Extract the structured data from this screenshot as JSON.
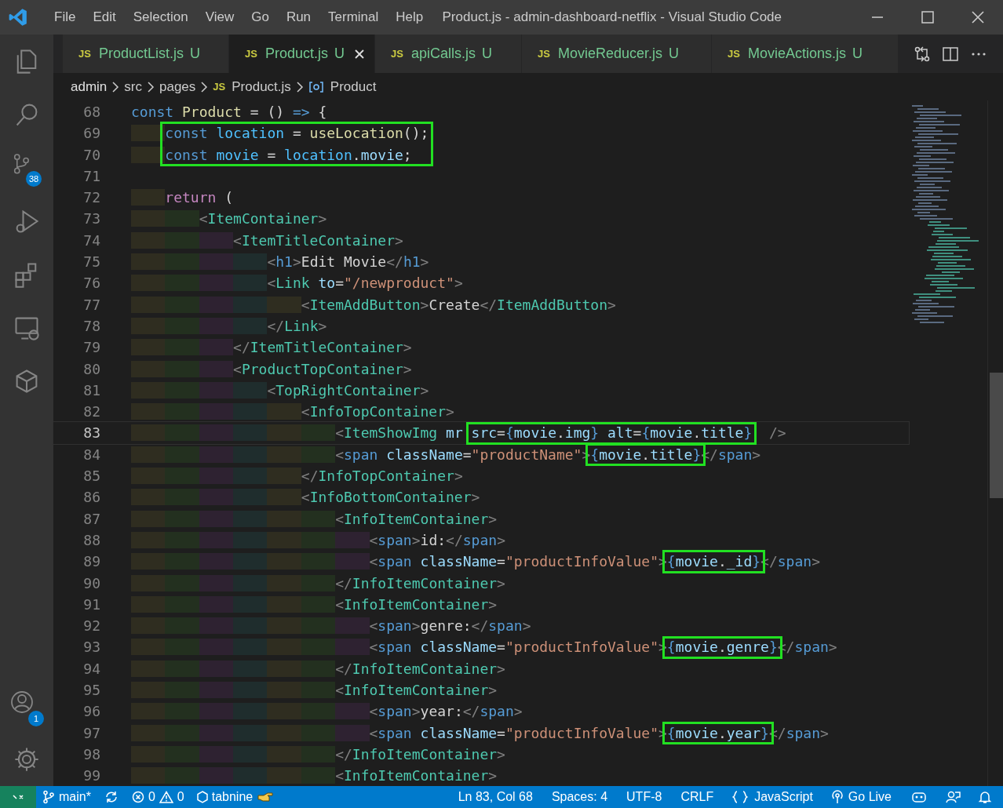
{
  "window": {
    "title": "Product.js - admin-dashboard-netflix - Visual Studio Code"
  },
  "menu": [
    "File",
    "Edit",
    "Selection",
    "View",
    "Go",
    "Run",
    "Terminal",
    "Help"
  ],
  "activity_bar": {
    "source_control_badge": "38",
    "accounts_badge": "1"
  },
  "tabs": [
    {
      "badge": "JS",
      "name": "ProductList.js",
      "status": "U",
      "selected": false
    },
    {
      "badge": "JS",
      "name": "Product.js",
      "status": "U",
      "selected": true
    },
    {
      "badge": "JS",
      "name": "apiCalls.js",
      "status": "U",
      "selected": false
    },
    {
      "badge": "JS",
      "name": "MovieReducer.js",
      "status": "U",
      "selected": false
    },
    {
      "badge": "JS",
      "name": "MovieActions.js",
      "status": "U",
      "selected": false
    }
  ],
  "breadcrumb": [
    {
      "kind": "folder",
      "text": "admin"
    },
    {
      "kind": "folder",
      "text": "src"
    },
    {
      "kind": "folder",
      "text": "pages"
    },
    {
      "kind": "file",
      "badge": "JS",
      "text": "Product.js"
    },
    {
      "kind": "symbol",
      "text": "Product"
    }
  ],
  "editor": {
    "lines": [
      {
        "kind": "line",
        "number": "68",
        "current": false,
        "tokens": [
          {
            "kind": "keyword",
            "text": "const"
          },
          {
            "kind": "function",
            "text": " Product"
          },
          {
            "kind": "plain",
            "text": " = () "
          },
          {
            "kind": "keyword",
            "text": "=>"
          },
          {
            "kind": "plain",
            "text": " {"
          }
        ]
      },
      {
        "kind": "boxed_block",
        "lines": [
          {
            "number": "69",
            "current": false,
            "tokens": [
              {
                "kind": "keyword",
                "text": "    const"
              },
              {
                "kind": "constant",
                "text": " location"
              },
              {
                "kind": "plain",
                "text": " = "
              },
              {
                "kind": "function",
                "text": "useLocation"
              },
              {
                "kind": "plain",
                "text": "();"
              }
            ]
          },
          {
            "number": "70",
            "current": false,
            "tokens": [
              {
                "kind": "keyword",
                "text": "    const"
              },
              {
                "kind": "constant",
                "text": " movie"
              },
              {
                "kind": "plain",
                "text": " = "
              },
              {
                "kind": "constant",
                "text": "location"
              },
              {
                "kind": "plain",
                "text": "."
              },
              {
                "kind": "variable",
                "text": "movie"
              },
              {
                "kind": "plain",
                "text": ";"
              }
            ]
          }
        ]
      },
      {
        "kind": "line",
        "number": "71",
        "current": false
      },
      {
        "kind": "line",
        "number": "72",
        "current": false,
        "tokens": [
          {
            "kind": "control",
            "text": "    return"
          },
          {
            "kind": "plain",
            "text": " ("
          }
        ]
      },
      {
        "kind": "line",
        "number": "73",
        "current": false,
        "tokens": [
          {
            "kind": "bracket",
            "text": "        <"
          },
          {
            "kind": "component",
            "text": "ItemContainer"
          },
          {
            "kind": "bracket",
            "text": ">"
          }
        ]
      },
      {
        "kind": "line",
        "number": "74",
        "current": false,
        "tokens": [
          {
            "kind": "bracket",
            "text": "            <"
          },
          {
            "kind": "component",
            "text": "ItemTitleContainer"
          },
          {
            "kind": "bracket",
            "text": ">"
          }
        ]
      },
      {
        "kind": "line",
        "number": "75",
        "current": false,
        "tokens": [
          {
            "kind": "bracket",
            "text": "                <"
          },
          {
            "kind": "tag",
            "text": "h1"
          },
          {
            "kind": "bracket",
            "text": ">"
          },
          {
            "kind": "plain",
            "text": "Edit Movie"
          },
          {
            "kind": "bracket",
            "text": "</"
          },
          {
            "kind": "tag",
            "text": "h1"
          },
          {
            "kind": "bracket",
            "text": ">"
          }
        ]
      },
      {
        "kind": "line",
        "number": "76",
        "current": false,
        "tokens": [
          {
            "kind": "bracket",
            "text": "                <"
          },
          {
            "kind": "component",
            "text": "Link"
          },
          {
            "kind": "attribute",
            "text": " to"
          },
          {
            "kind": "plain",
            "text": "="
          },
          {
            "kind": "string",
            "text": "\"/newproduct\""
          },
          {
            "kind": "bracket",
            "text": ">"
          }
        ]
      },
      {
        "kind": "line",
        "number": "77",
        "current": false,
        "tokens": [
          {
            "kind": "bracket",
            "text": "                    <"
          },
          {
            "kind": "component",
            "text": "ItemAddButton"
          },
          {
            "kind": "bracket",
            "text": ">"
          },
          {
            "kind": "plain",
            "text": "Create"
          },
          {
            "kind": "bracket",
            "text": "</"
          },
          {
            "kind": "component",
            "text": "ItemAddButton"
          },
          {
            "kind": "bracket",
            "text": ">"
          }
        ]
      },
      {
        "kind": "line",
        "number": "78",
        "current": false,
        "tokens": [
          {
            "kind": "bracket",
            "text": "                </"
          },
          {
            "kind": "component",
            "text": "Link"
          },
          {
            "kind": "bracket",
            "text": ">"
          }
        ]
      },
      {
        "kind": "line",
        "number": "79",
        "current": false,
        "tokens": [
          {
            "kind": "bracket",
            "text": "            </"
          },
          {
            "kind": "component",
            "text": "ItemTitleContainer"
          },
          {
            "kind": "bracket",
            "text": ">"
          }
        ]
      },
      {
        "kind": "line",
        "number": "80",
        "current": false,
        "tokens": [
          {
            "kind": "bracket",
            "text": "            <"
          },
          {
            "kind": "component",
            "text": "ProductTopContainer"
          },
          {
            "kind": "bracket",
            "text": ">"
          }
        ]
      },
      {
        "kind": "line",
        "number": "81",
        "current": false,
        "tokens": [
          {
            "kind": "bracket",
            "text": "                <"
          },
          {
            "kind": "component",
            "text": "TopRightContainer"
          },
          {
            "kind": "bracket",
            "text": ">"
          }
        ]
      },
      {
        "kind": "line",
        "number": "82",
        "current": false,
        "tokens": [
          {
            "kind": "bracket",
            "text": "                    <"
          },
          {
            "kind": "component",
            "text": "InfoTopContainer"
          },
          {
            "kind": "bracket",
            "text": ">"
          }
        ]
      },
      {
        "kind": "line",
        "number": "83",
        "current": true,
        "tokens": [
          {
            "kind": "bracket",
            "text": "                        <"
          },
          {
            "kind": "component",
            "text": "ItemShowImg"
          },
          {
            "kind": "attribute",
            "text": " mr "
          },
          {
            "kind": "boxed",
            "tokens": [
              {
                "kind": "attribute",
                "text": "src"
              },
              {
                "kind": "plain",
                "text": "="
              },
              {
                "kind": "brace",
                "text": "{"
              },
              {
                "kind": "variable",
                "text": "movie"
              },
              {
                "kind": "plain",
                "text": "."
              },
              {
                "kind": "variable",
                "text": "img"
              },
              {
                "kind": "brace",
                "text": "}"
              },
              {
                "kind": "attribute",
                "text": " alt"
              },
              {
                "kind": "plain",
                "text": "="
              },
              {
                "kind": "brace",
                "text": "{"
              },
              {
                "kind": "variable",
                "text": "movie"
              },
              {
                "kind": "plain",
                "text": "."
              },
              {
                "kind": "variable",
                "text": "title"
              },
              {
                "kind": "brace",
                "text": "}"
              }
            ]
          },
          {
            "kind": "bracket",
            "text": "  />"
          }
        ]
      },
      {
        "kind": "line",
        "number": "84",
        "current": false,
        "tokens": [
          {
            "kind": "bracket",
            "text": "                        <"
          },
          {
            "kind": "tag",
            "text": "span"
          },
          {
            "kind": "attribute",
            "text": " className"
          },
          {
            "kind": "plain",
            "text": "="
          },
          {
            "kind": "string",
            "text": "\"productName\""
          },
          {
            "kind": "bracket",
            "text": ">"
          },
          {
            "kind": "boxed",
            "tokens": [
              {
                "kind": "brace",
                "text": "{"
              },
              {
                "kind": "variable",
                "text": "movie"
              },
              {
                "kind": "plain",
                "text": "."
              },
              {
                "kind": "variable",
                "text": "title"
              },
              {
                "kind": "brace",
                "text": "}"
              }
            ]
          },
          {
            "kind": "bracket",
            "text": "</"
          },
          {
            "kind": "tag",
            "text": "span"
          },
          {
            "kind": "bracket",
            "text": ">"
          }
        ]
      },
      {
        "kind": "line",
        "number": "85",
        "current": false,
        "tokens": [
          {
            "kind": "bracket",
            "text": "                    </"
          },
          {
            "kind": "component",
            "text": "InfoTopContainer"
          },
          {
            "kind": "bracket",
            "text": ">"
          }
        ]
      },
      {
        "kind": "line",
        "number": "86",
        "current": false,
        "tokens": [
          {
            "kind": "bracket",
            "text": "                    <"
          },
          {
            "kind": "component",
            "text": "InfoBottomContainer"
          },
          {
            "kind": "bracket",
            "text": ">"
          }
        ]
      },
      {
        "kind": "line",
        "number": "87",
        "current": false,
        "tokens": [
          {
            "kind": "bracket",
            "text": "                        <"
          },
          {
            "kind": "component",
            "text": "InfoItemContainer"
          },
          {
            "kind": "bracket",
            "text": ">"
          }
        ]
      },
      {
        "kind": "line",
        "number": "88",
        "current": false,
        "tokens": [
          {
            "kind": "bracket",
            "text": "                            <"
          },
          {
            "kind": "tag",
            "text": "span"
          },
          {
            "kind": "bracket",
            "text": ">"
          },
          {
            "kind": "plain",
            "text": "id:"
          },
          {
            "kind": "bracket",
            "text": "</"
          },
          {
            "kind": "tag",
            "text": "span"
          },
          {
            "kind": "bracket",
            "text": ">"
          }
        ]
      },
      {
        "kind": "line",
        "number": "89",
        "current": false,
        "tokens": [
          {
            "kind": "bracket",
            "text": "                            <"
          },
          {
            "kind": "tag",
            "text": "span"
          },
          {
            "kind": "attribute",
            "text": " className"
          },
          {
            "kind": "plain",
            "text": "="
          },
          {
            "kind": "string",
            "text": "\"productInfoValue\""
          },
          {
            "kind": "bracket",
            "text": ">"
          },
          {
            "kind": "boxed",
            "tokens": [
              {
                "kind": "brace",
                "text": "{"
              },
              {
                "kind": "variable",
                "text": "movie"
              },
              {
                "kind": "plain",
                "text": "."
              },
              {
                "kind": "variable",
                "text": "_id"
              },
              {
                "kind": "brace",
                "text": "}"
              }
            ]
          },
          {
            "kind": "bracket",
            "text": "</"
          },
          {
            "kind": "tag",
            "text": "span"
          },
          {
            "kind": "bracket",
            "text": ">"
          }
        ]
      },
      {
        "kind": "line",
        "number": "90",
        "current": false,
        "tokens": [
          {
            "kind": "bracket",
            "text": "                        </"
          },
          {
            "kind": "component",
            "text": "InfoItemContainer"
          },
          {
            "kind": "bracket",
            "text": ">"
          }
        ]
      },
      {
        "kind": "line",
        "number": "91",
        "current": false,
        "tokens": [
          {
            "kind": "bracket",
            "text": "                        <"
          },
          {
            "kind": "component",
            "text": "InfoItemContainer"
          },
          {
            "kind": "bracket",
            "text": ">"
          }
        ]
      },
      {
        "kind": "line",
        "number": "92",
        "current": false,
        "tokens": [
          {
            "kind": "bracket",
            "text": "                            <"
          },
          {
            "kind": "tag",
            "text": "span"
          },
          {
            "kind": "bracket",
            "text": ">"
          },
          {
            "kind": "plain",
            "text": "genre:"
          },
          {
            "kind": "bracket",
            "text": "</"
          },
          {
            "kind": "tag",
            "text": "span"
          },
          {
            "kind": "bracket",
            "text": ">"
          }
        ]
      },
      {
        "kind": "line",
        "number": "93",
        "current": false,
        "tokens": [
          {
            "kind": "bracket",
            "text": "                            <"
          },
          {
            "kind": "tag",
            "text": "span"
          },
          {
            "kind": "attribute",
            "text": " className"
          },
          {
            "kind": "plain",
            "text": "="
          },
          {
            "kind": "string",
            "text": "\"productInfoValue\""
          },
          {
            "kind": "bracket",
            "text": ">"
          },
          {
            "kind": "boxed",
            "tokens": [
              {
                "kind": "brace",
                "text": "{"
              },
              {
                "kind": "variable",
                "text": "movie"
              },
              {
                "kind": "plain",
                "text": "."
              },
              {
                "kind": "variable",
                "text": "genre"
              },
              {
                "kind": "brace",
                "text": "}"
              }
            ]
          },
          {
            "kind": "bracket",
            "text": "</"
          },
          {
            "kind": "tag",
            "text": "span"
          },
          {
            "kind": "bracket",
            "text": ">"
          }
        ]
      },
      {
        "kind": "line",
        "number": "94",
        "current": false,
        "tokens": [
          {
            "kind": "bracket",
            "text": "                        </"
          },
          {
            "kind": "component",
            "text": "InfoItemContainer"
          },
          {
            "kind": "bracket",
            "text": ">"
          }
        ]
      },
      {
        "kind": "line",
        "number": "95",
        "current": false,
        "tokens": [
          {
            "kind": "bracket",
            "text": "                        <"
          },
          {
            "kind": "component",
            "text": "InfoItemContainer"
          },
          {
            "kind": "bracket",
            "text": ">"
          }
        ]
      },
      {
        "kind": "line",
        "number": "96",
        "current": false,
        "tokens": [
          {
            "kind": "bracket",
            "text": "                            <"
          },
          {
            "kind": "tag",
            "text": "span"
          },
          {
            "kind": "bracket",
            "text": ">"
          },
          {
            "kind": "plain",
            "text": "year:"
          },
          {
            "kind": "bracket",
            "text": "</"
          },
          {
            "kind": "tag",
            "text": "span"
          },
          {
            "kind": "bracket",
            "text": ">"
          }
        ]
      },
      {
        "kind": "line",
        "number": "97",
        "current": false,
        "tokens": [
          {
            "kind": "bracket",
            "text": "                            <"
          },
          {
            "kind": "tag",
            "text": "span"
          },
          {
            "kind": "attribute",
            "text": " className"
          },
          {
            "kind": "plain",
            "text": "="
          },
          {
            "kind": "string",
            "text": "\"productInfoValue\""
          },
          {
            "kind": "bracket",
            "text": ">"
          },
          {
            "kind": "boxed",
            "tokens": [
              {
                "kind": "brace",
                "text": "{"
              },
              {
                "kind": "variable",
                "text": "movie"
              },
              {
                "kind": "plain",
                "text": "."
              },
              {
                "kind": "variable",
                "text": "year"
              },
              {
                "kind": "brace",
                "text": "}"
              }
            ]
          },
          {
            "kind": "bracket",
            "text": "</"
          },
          {
            "kind": "tag",
            "text": "span"
          },
          {
            "kind": "bracket",
            "text": ">"
          }
        ]
      },
      {
        "kind": "line",
        "number": "98",
        "current": false,
        "tokens": [
          {
            "kind": "bracket",
            "text": "                        </"
          },
          {
            "kind": "component",
            "text": "InfoItemContainer"
          },
          {
            "kind": "bracket",
            "text": ">"
          }
        ]
      },
      {
        "kind": "line",
        "number": "99",
        "current": false,
        "tokens": [
          {
            "kind": "bracket",
            "text": "                        <"
          },
          {
            "kind": "component",
            "text": "InfoItemContainer"
          },
          {
            "kind": "bracket",
            "text": ">"
          }
        ]
      }
    ]
  },
  "status_bar": {
    "branch": "main*",
    "errors": "0",
    "warnings": "0",
    "tabnine": "tabnine",
    "position": "Ln 83, Col 68",
    "indentation": "Spaces: 4",
    "encoding": "UTF-8",
    "line_ending": "CRLF",
    "language": "JavaScript",
    "live_server": "Go Live"
  }
}
